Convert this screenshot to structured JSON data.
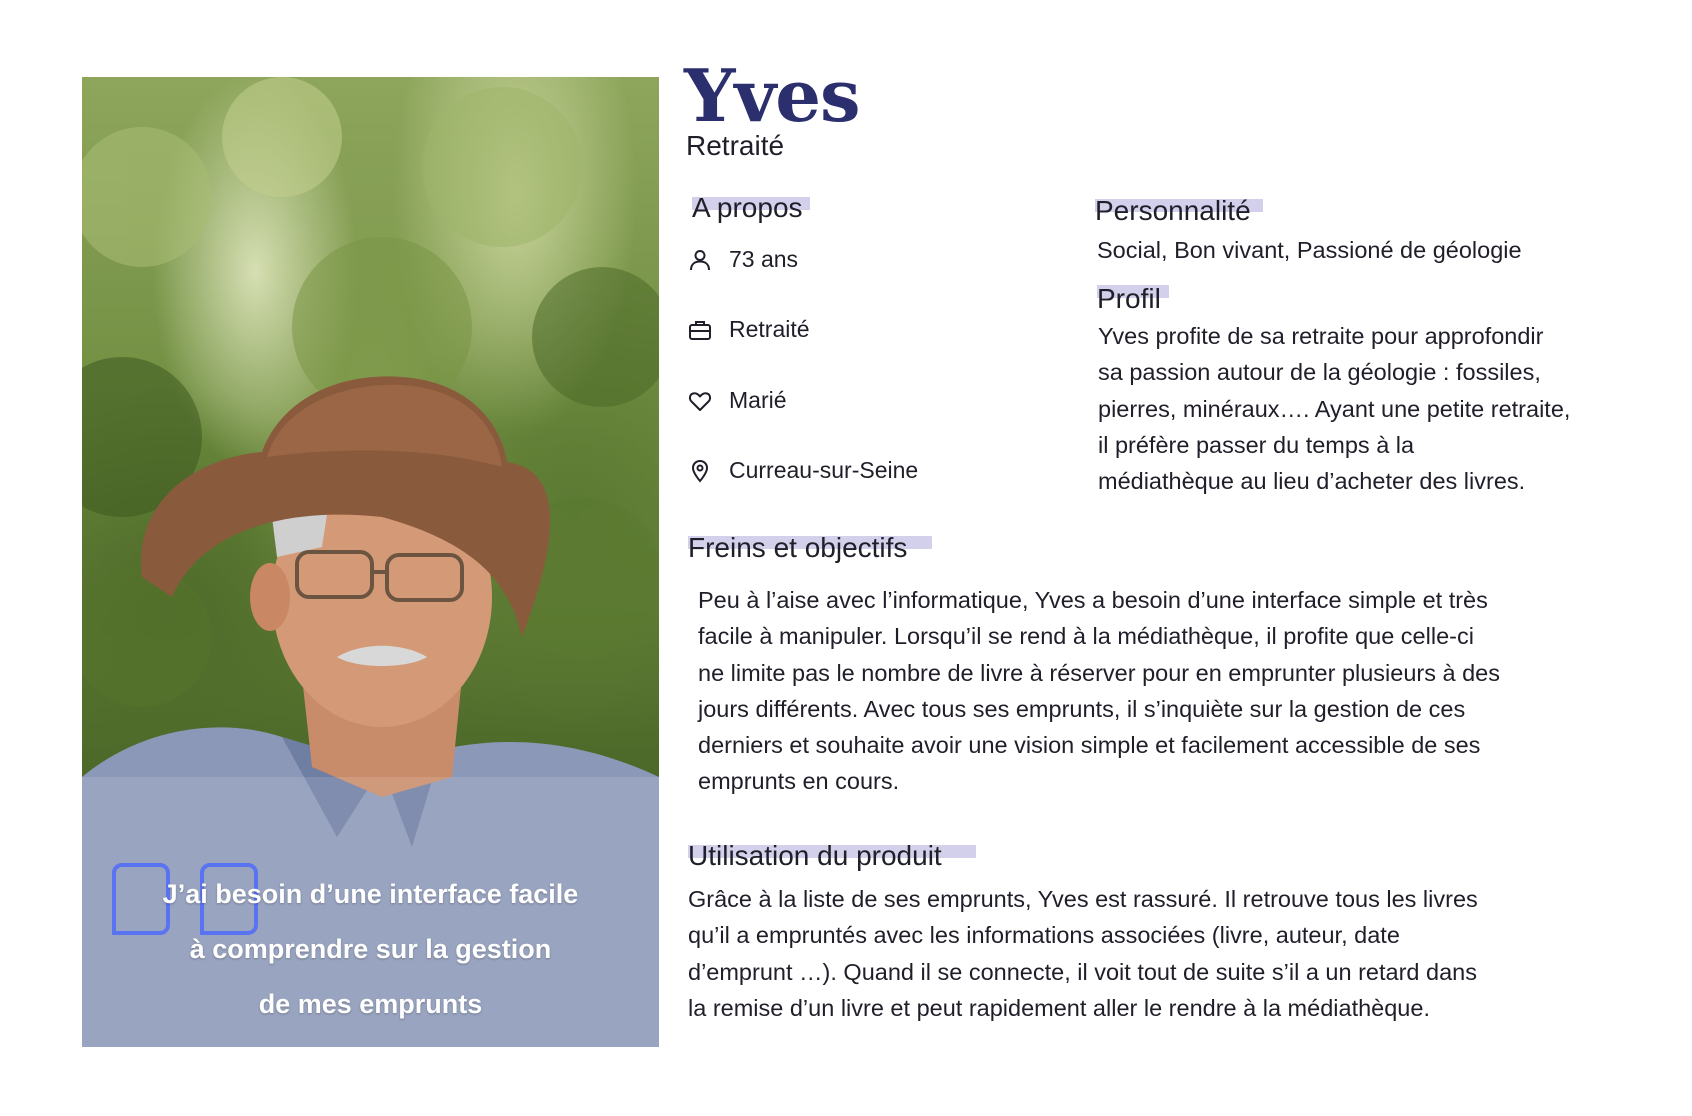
{
  "persona": {
    "name": "Yves",
    "role": "Retraité"
  },
  "quote": {
    "lines": [
      "J’ai besoin d’une interface facile",
      "à comprendre  sur la gestion",
      "de mes emprunts"
    ]
  },
  "about": {
    "title": "A propos",
    "items": [
      {
        "icon": "person-icon",
        "text": "73 ans"
      },
      {
        "icon": "briefcase-icon",
        "text": "Retraité"
      },
      {
        "icon": "heart-icon",
        "text": "Marié"
      },
      {
        "icon": "location-pin-icon",
        "text": "Curreau-sur-Seine"
      }
    ]
  },
  "personality": {
    "title": "Personnalité",
    "text": "Social, Bon vivant, Passioné de géologie"
  },
  "profile": {
    "title": "Profil",
    "lines": [
      "Yves profite de sa retraite pour approfondir",
      "sa passion autour de la géologie : fossiles,",
      "pierres, minéraux…. Ayant une petite retraite,",
      "il préfère passer du temps à la",
      "médiathèque au lieu d’acheter des livres."
    ]
  },
  "goals": {
    "title": "Freins et objectifs",
    "lines": [
      "Peu à l’aise avec l’informatique, Yves a besoin d’une interface simple et très",
      "facile à manipuler. Lorsqu’il se rend à la médiathèque, il profite que celle-ci",
      "ne limite pas le nombre de livre à réserver pour en emprunter plusieurs à des",
      "jours différents. Avec tous ses emprunts, il s’inquiète sur la gestion de ces",
      "derniers et souhaite avoir une vision simple et facilement accessible de ses",
      "emprunts en cours."
    ]
  },
  "usage": {
    "title": "Utilisation du produit",
    "lines": [
      "Grâce à la liste de ses emprunts, Yves est rassuré. Il retrouve tous les livres",
      "qu’il a empruntés avec les informations associées (livre, auteur, date",
      "d’emprunt …). Quand il se connecte, il voit tout de suite s’il a un retard dans",
      "la remise d’un livre et peut rapidement aller le rendre à la médiathèque."
    ]
  },
  "colors": {
    "name": "#2c2f6e",
    "highlight": "#d2d0ea",
    "quote_mark": "#5a73f0"
  }
}
